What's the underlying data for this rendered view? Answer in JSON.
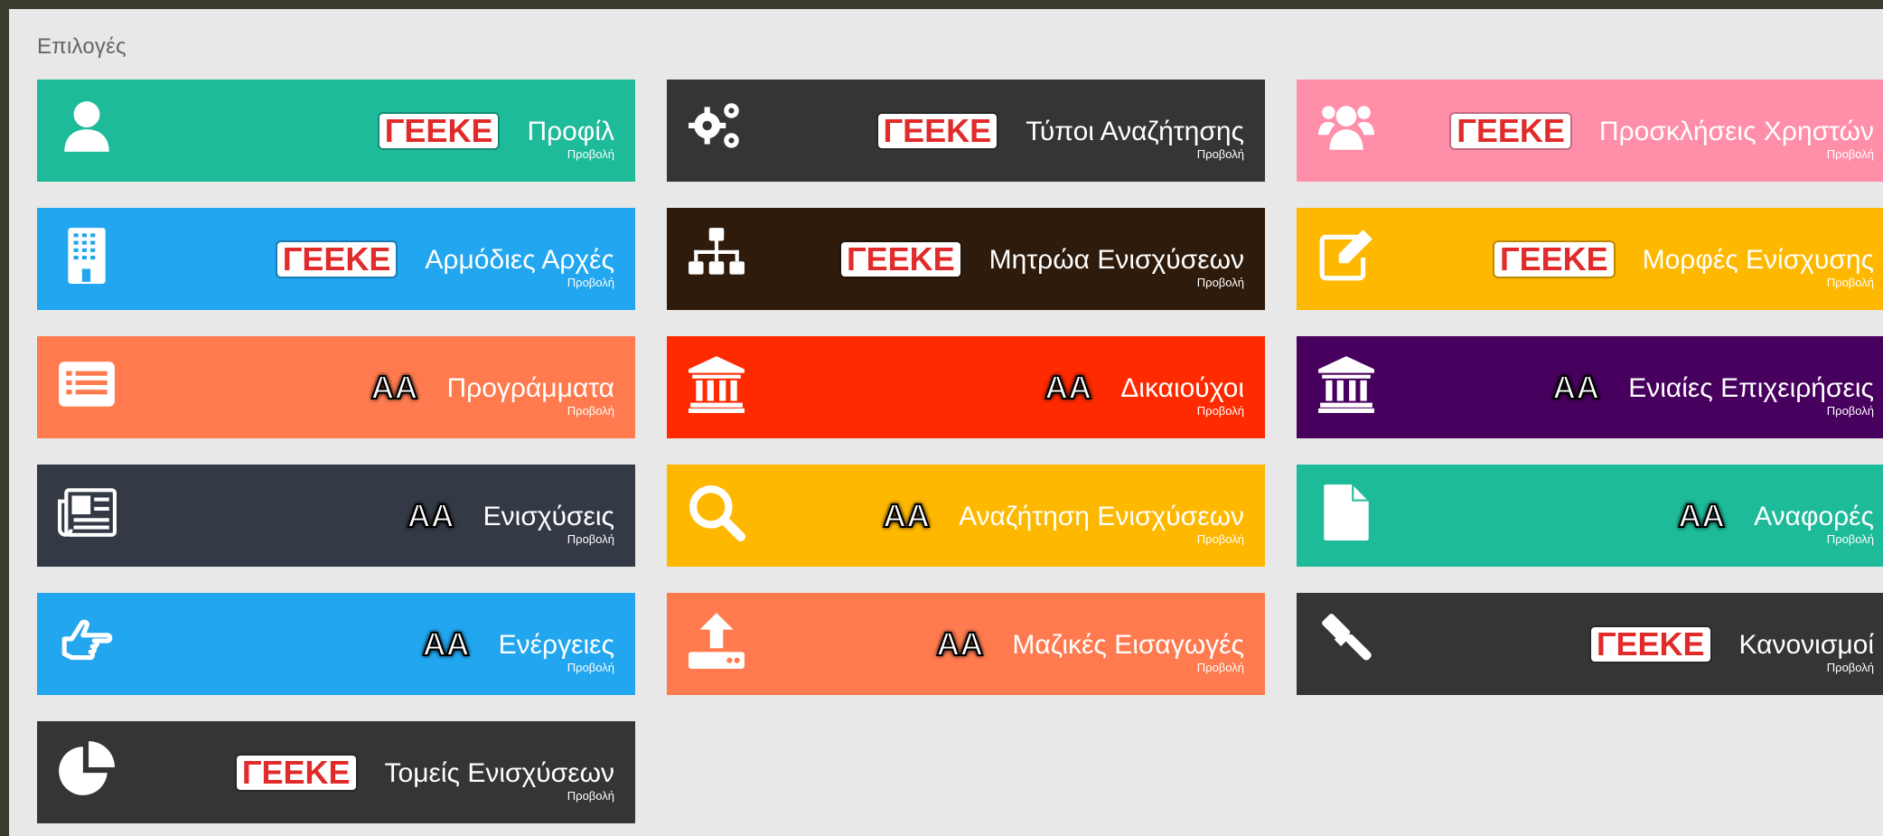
{
  "section": {
    "title": "Επιλογές"
  },
  "badges": {
    "geeke": "ΓΕΕΚΕ",
    "aa": "ΑΑ"
  },
  "tiles": [
    {
      "title": "Προφίλ",
      "view": "Προβολή",
      "badge": "geeke",
      "icon": "user-icon",
      "color": "#1dbb99"
    },
    {
      "title": "Τύποι Αναζήτησης",
      "view": "Προβολή",
      "badge": "geeke",
      "icon": "gears-icon",
      "color": "#353535"
    },
    {
      "title": "Προσκλήσεις Χρηστών",
      "view": "Προβολή",
      "badge": "geeke",
      "icon": "users-icon",
      "color": "#ff8fa8"
    },
    {
      "title": "Αρμόδιες Αρχές",
      "view": "Προβολή",
      "badge": "geeke",
      "icon": "building-icon",
      "color": "#22a6ef"
    },
    {
      "title": "Μητρώα Ενισχύσεων",
      "view": "Προβολή",
      "badge": "geeke",
      "icon": "sitemap-icon",
      "color": "#2e1b0c"
    },
    {
      "title": "Μορφές Ενίσχυσης",
      "view": "Προβολή",
      "badge": "geeke",
      "icon": "edit-icon",
      "color": "#ffb800"
    },
    {
      "title": "Προγράμματα",
      "view": "Προβολή",
      "badge": "aa",
      "icon": "list-alt-icon",
      "color": "#ff7b4f"
    },
    {
      "title": "Δικαιούχοι",
      "view": "Προβολή",
      "badge": "aa",
      "icon": "bank-icon",
      "color": "#ff2a00"
    },
    {
      "title": "Ενιαίες Επιχειρήσεις",
      "view": "Προβολή",
      "badge": "aa",
      "icon": "bank-icon",
      "color": "#47005e"
    },
    {
      "title": "Ενισχύσεις",
      "view": "Προβολή",
      "badge": "aa",
      "icon": "newspaper-icon",
      "color": "#343a45"
    },
    {
      "title": "Αναζήτηση Ενισχύσεων",
      "view": "Προβολή",
      "badge": "aa",
      "icon": "search-icon",
      "color": "#ffb800"
    },
    {
      "title": "Αναφορές",
      "view": "Προβολή",
      "badge": "aa",
      "icon": "file-icon",
      "color": "#1dbb99"
    },
    {
      "title": "Ενέργειες",
      "view": "Προβολή",
      "badge": "aa",
      "icon": "hand-pointer-icon",
      "color": "#22a6ef"
    },
    {
      "title": "Μαζικές Εισαγωγές",
      "view": "Προβολή",
      "badge": "aa",
      "icon": "upload-icon",
      "color": "#ff7b4f"
    },
    {
      "title": "Κανονισμοί",
      "view": "Προβολή",
      "badge": "geeke",
      "icon": "gavel-icon",
      "color": "#353535"
    },
    {
      "title": "Τομείς Ενισχύσεων",
      "view": "Προβολή",
      "badge": "geeke",
      "icon": "pie-chart-icon",
      "color": "#353535"
    }
  ]
}
